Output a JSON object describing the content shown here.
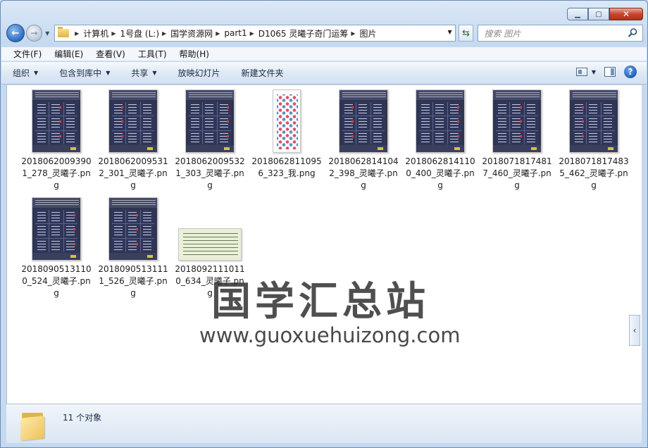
{
  "window": {
    "caption_buttons": [
      "minimize",
      "maximize",
      "close"
    ]
  },
  "address_bar": {
    "crumbs": [
      "计算机",
      "1号盘 (L:)",
      "国学资源网",
      "part1",
      "D1065 灵曦子奇门运筹",
      "图片"
    ]
  },
  "search": {
    "placeholder": "搜索 图片"
  },
  "menu": [
    "文件(F)",
    "编辑(E)",
    "查看(V)",
    "工具(T)",
    "帮助(H)"
  ],
  "commands": {
    "organize": "组织",
    "include_in_library": "包含到库中",
    "share": "共享",
    "slideshow": "放映幻灯片",
    "new_folder": "新建文件夹"
  },
  "files": [
    {
      "name": "20180620093901_278_灵曦子.png",
      "thumb": "chart"
    },
    {
      "name": "20180620095312_301_灵曦子.png",
      "thumb": "chart"
    },
    {
      "name": "20180620095321_303_灵曦子.png",
      "thumb": "chart"
    },
    {
      "name": "20180628110956_323_我.png",
      "thumb": "white"
    },
    {
      "name": "20180628141042_398_灵曦子.png",
      "thumb": "chart"
    },
    {
      "name": "20180628141100_400_灵曦子.png",
      "thumb": "chart"
    },
    {
      "name": "20180718174817_460_灵曦子.png",
      "thumb": "chart"
    },
    {
      "name": "20180718174835_462_灵曦子.png",
      "thumb": "chart"
    },
    {
      "name": "20180905131100_524_灵曦子.png",
      "thumb": "chart"
    },
    {
      "name": "20180905131111_526_灵曦子.png",
      "thumb": "chart"
    },
    {
      "name": "20180921110110_634_灵曦子.png",
      "thumb": "doc"
    }
  ],
  "watermark": {
    "cn": "国学汇总站",
    "en": "www.guoxuehuizong.com"
  },
  "status": {
    "count": "11 个对象"
  }
}
